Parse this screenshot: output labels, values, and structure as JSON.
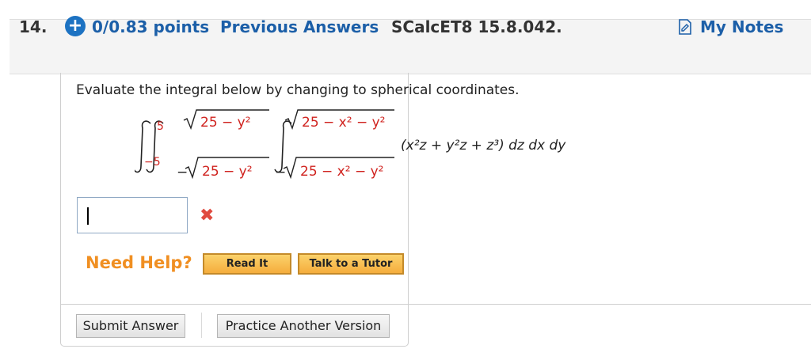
{
  "header": {
    "question_number": "14.",
    "points": "0/0.83 points",
    "previous_answers": "Previous Answers",
    "problem_code": "SCalcET8 15.8.042.",
    "my_notes": "My Notes"
  },
  "question": {
    "prompt": "Evaluate the integral below by changing to spherical coordinates.",
    "limits": {
      "outer_upper": "5",
      "outer_lower": "−5",
      "middle_upper": "25 − y²",
      "middle_lower": "25 − y²",
      "inner_upper": "25 − x² − y²",
      "inner_lower": "25 − x² − y²"
    },
    "integrand": "(x²z + y²z + z³) dz dx dy"
  },
  "answer": {
    "value": "",
    "status": "incorrect"
  },
  "help": {
    "label": "Need Help?",
    "read_it": "Read It",
    "talk_to_tutor": "Talk to a Tutor"
  },
  "actions": {
    "submit": "Submit Answer",
    "practice": "Practice Another Version"
  },
  "colors": {
    "link_blue": "#1c5fa8",
    "need_help_orange": "#f08f22",
    "limit_red": "#d0231f",
    "error_red": "#e04a3f"
  }
}
